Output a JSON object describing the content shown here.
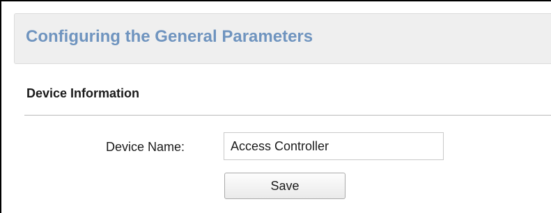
{
  "header": {
    "title": "Configuring the General Parameters"
  },
  "section": {
    "title": "Device Information"
  },
  "form": {
    "device_name_label": "Device Name:",
    "device_name_value": "Access Controller",
    "save_label": "Save"
  },
  "colors": {
    "title_blue": "#6f94bf",
    "header_background": "#efefef",
    "text": "#1a1a1a",
    "divider": "#b9b9b9"
  }
}
